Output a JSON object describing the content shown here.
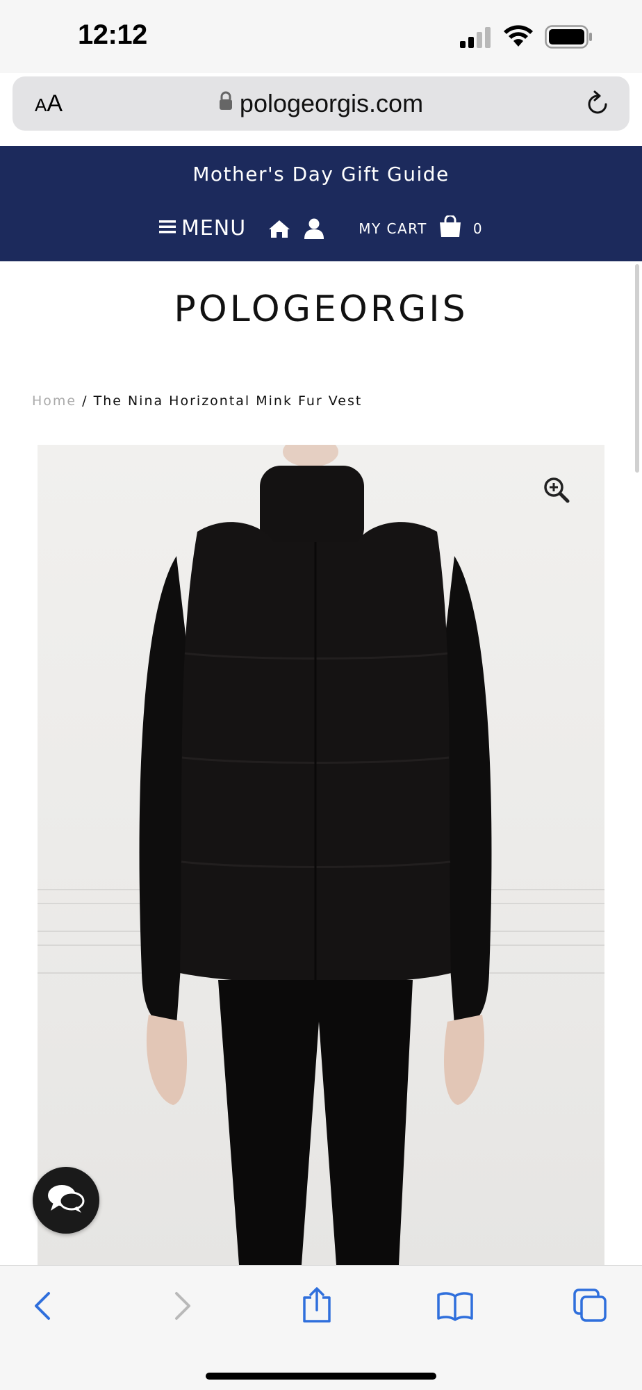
{
  "status": {
    "time": "12:12"
  },
  "browser": {
    "aa_label_small": "A",
    "aa_label_large": "A",
    "url": "pologeorgis.com"
  },
  "header": {
    "promo": "Mother's Day Gift Guide",
    "menu_label": "MENU",
    "cart_label": "MY CART",
    "cart_count": "0",
    "bg_color": "#1c2a5c"
  },
  "site": {
    "logo": "POLOGEORGIS"
  },
  "breadcrumb": {
    "home": "Home",
    "separator": " / ",
    "current": "The Nina Horizontal Mink Fur Vest"
  },
  "product": {
    "image_alt": "The Nina Horizontal Mink Fur Vest"
  },
  "icons": {
    "signal": "signal-icon",
    "wifi": "wifi-icon",
    "battery": "battery-icon",
    "lock": "lock-icon",
    "reload": "reload-icon",
    "hamburger": "hamburger-icon",
    "home": "home-icon",
    "user": "user-icon",
    "bag": "shopping-bag-icon",
    "zoom": "zoom-in-icon",
    "chat": "chat-icon",
    "back": "back-arrow-icon",
    "forward": "forward-arrow-icon",
    "share": "share-icon",
    "bookmarks": "bookmarks-icon",
    "tabs": "tabs-icon"
  }
}
